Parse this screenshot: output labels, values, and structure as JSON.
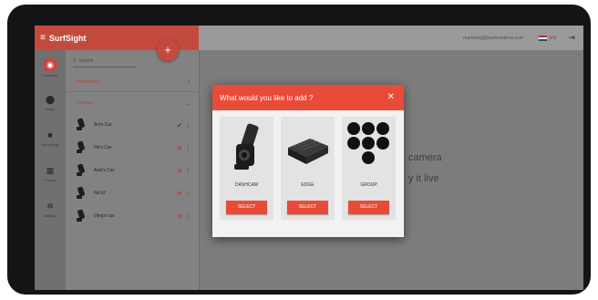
{
  "header": {
    "brand": "SurfSight",
    "account_email": "marketing@surfsolutions.com",
    "language": "EN"
  },
  "sidebar": {
    "items": [
      {
        "label": "Cameras",
        "icon": "camera-icon",
        "active": true
      },
      {
        "label": "Maps",
        "icon": "map-pin-icon"
      },
      {
        "label": "Recordings",
        "icon": "video-icon"
      },
      {
        "label": "Events",
        "icon": "calendar-icon"
      },
      {
        "label": "Settings",
        "icon": "gear-icon"
      }
    ]
  },
  "panel": {
    "search_placeholder": "Search",
    "sections": [
      {
        "label": "Bookmarks",
        "chevron": "›"
      },
      {
        "label": "Devices",
        "chevron": "⌄"
      }
    ],
    "devices": [
      {
        "name": "Avi's Car",
        "status": "online",
        "symbol": "✓"
      },
      {
        "name": "Nir's Car",
        "status": "offline",
        "symbol": "✕"
      },
      {
        "name": "Assi's Car",
        "status": "offline",
        "symbol": "✕"
      },
      {
        "name": "Nir's2",
        "status": "offline",
        "symbol": "✕"
      },
      {
        "name": "Oleg's car",
        "status": "offline",
        "symbol": "✕"
      }
    ]
  },
  "background_text": {
    "line1": "camera",
    "line2": "y it live"
  },
  "modal": {
    "title": "What would you like to add ?",
    "options": [
      {
        "label": "DASHCAM",
        "button": "SELECT"
      },
      {
        "label": "EDGE",
        "button": "SELECT"
      },
      {
        "label": "GROUP",
        "button": "SELECT"
      }
    ]
  },
  "colors": {
    "accent": "#e84b38",
    "brand_bar": "#c44a40",
    "status_ok": "#222222",
    "status_error": "#c0302a"
  }
}
